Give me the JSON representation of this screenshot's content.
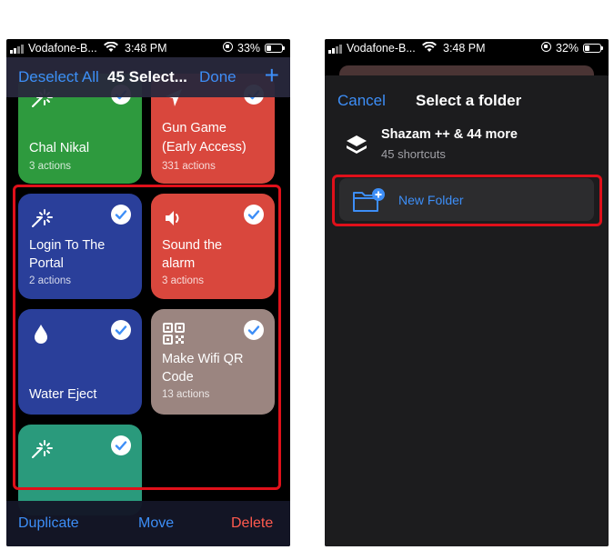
{
  "left": {
    "status": {
      "carrier": "Vodafone-B...",
      "time": "3:48 PM",
      "battery": "33%",
      "battery_level": 0.33
    },
    "nav": {
      "deselect": "Deselect All",
      "title": "45 Select...",
      "done": "Done",
      "add": "+"
    },
    "tiles": [
      {
        "name_lines": [
          "Chal Nikal"
        ],
        "sub": "3 actions",
        "color": "#2e9a3e",
        "icon": "magic-wand-icon"
      },
      {
        "name_lines": [
          "Gun Game",
          "(Early Access)"
        ],
        "sub": "331 actions",
        "color": "#d9473d",
        "icon": "location-arrow-icon"
      },
      {
        "name_lines": [
          "Login To The",
          "Portal"
        ],
        "sub": "2 actions",
        "color": "#2a3f9a",
        "icon": "magic-wand-icon"
      },
      {
        "name_lines": [
          "Sound the",
          "alarm"
        ],
        "sub": "3 actions",
        "color": "#d9473d",
        "icon": "speaker-icon"
      },
      {
        "name_lines": [
          "Water Eject"
        ],
        "sub": "",
        "color": "#2a3f9a",
        "icon": "water-drop-icon"
      },
      {
        "name_lines": [
          "Make Wifi QR",
          "Code"
        ],
        "sub": "13 actions",
        "color": "#9b8580",
        "icon": "qr-code-icon"
      },
      {
        "name_lines": [],
        "sub": "",
        "color": "#2a9a7c",
        "icon": "magic-wand-icon"
      }
    ],
    "toolbar": {
      "duplicate": "Duplicate",
      "move": "Move",
      "delete": "Delete"
    }
  },
  "right": {
    "status": {
      "carrier": "Vodafone-B...",
      "time": "3:48 PM",
      "battery": "32%",
      "battery_level": 0.32
    },
    "sheet": {
      "cancel": "Cancel",
      "title": "Select a folder"
    },
    "folder": {
      "name": "Shazam ++ & 44 more",
      "sub": "45 shortcuts",
      "icon": "stack-icon"
    },
    "new_folder": {
      "label": "New Folder",
      "icon": "folder-plus-icon"
    }
  },
  "colors": {
    "accent": "#3d8ef7",
    "highlight": "#e0101a",
    "delete": "#ff5a4e"
  }
}
